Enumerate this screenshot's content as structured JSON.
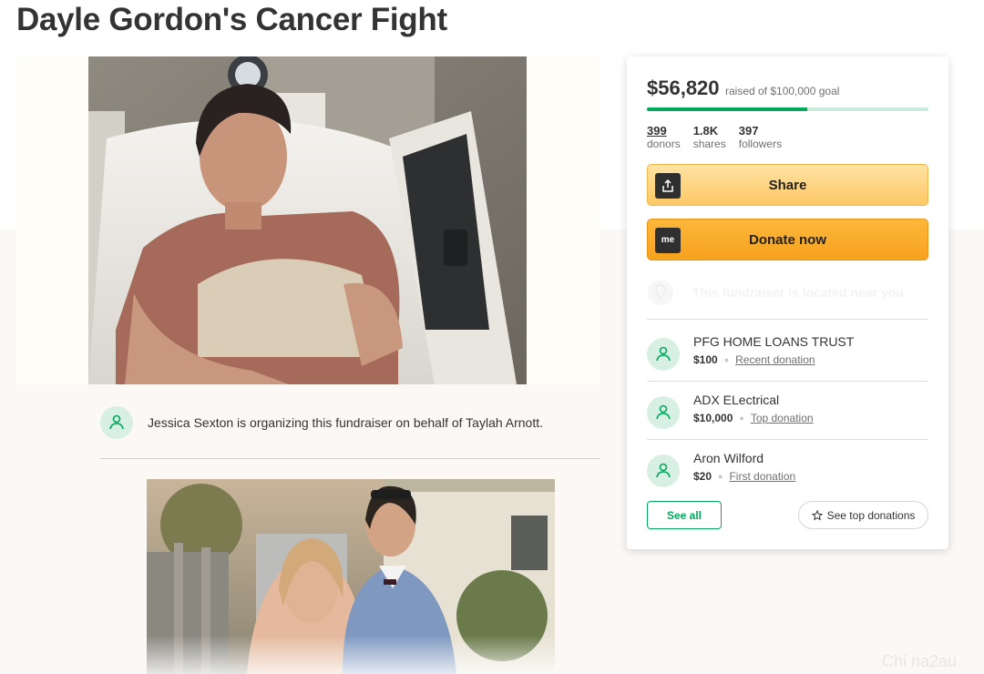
{
  "page": {
    "title": "Dayle Gordon's Cancer Fight"
  },
  "organizer": {
    "text": "Jessica Sexton is organizing this fundraiser on behalf of Taylah Arnott."
  },
  "donation_card": {
    "raised_amount": "$56,820",
    "goal_text": "raised of $100,000 goal",
    "progress_fraction": 0.5682,
    "stats": [
      {
        "value": "399",
        "label": "donors"
      },
      {
        "value": "1.8K",
        "label": "shares"
      },
      {
        "value": "397",
        "label": "followers"
      }
    ],
    "share_label": "Share",
    "donate_label": "Donate now",
    "donate_icon_text": "me",
    "location_text": "This fundraiser is located near you",
    "donations": [
      {
        "name": "PFG HOME LOANS TRUST",
        "amount": "$100",
        "tag": "Recent donation"
      },
      {
        "name": "ADX ELectrical",
        "amount": "$10,000",
        "tag": "Top donation"
      },
      {
        "name": "Aron Wilford",
        "amount": "$20",
        "tag": "First donation"
      }
    ],
    "see_all_label": "See all",
    "see_top_label": "See top donations"
  },
  "watermark": "Chi na2au",
  "colors": {
    "brand_green": "#02a95c",
    "progress_track": "#c8ecdc",
    "share_button": "#fdc866",
    "donate_button": "#f6a21e"
  },
  "icons": {
    "share_button_icon": "upload-icon",
    "donate_button_icon": "gofundme-logo-icon",
    "location_icon": "map-pin-icon",
    "donor_icon": "hand-heart-icon",
    "see_top_icon": "star-icon"
  }
}
